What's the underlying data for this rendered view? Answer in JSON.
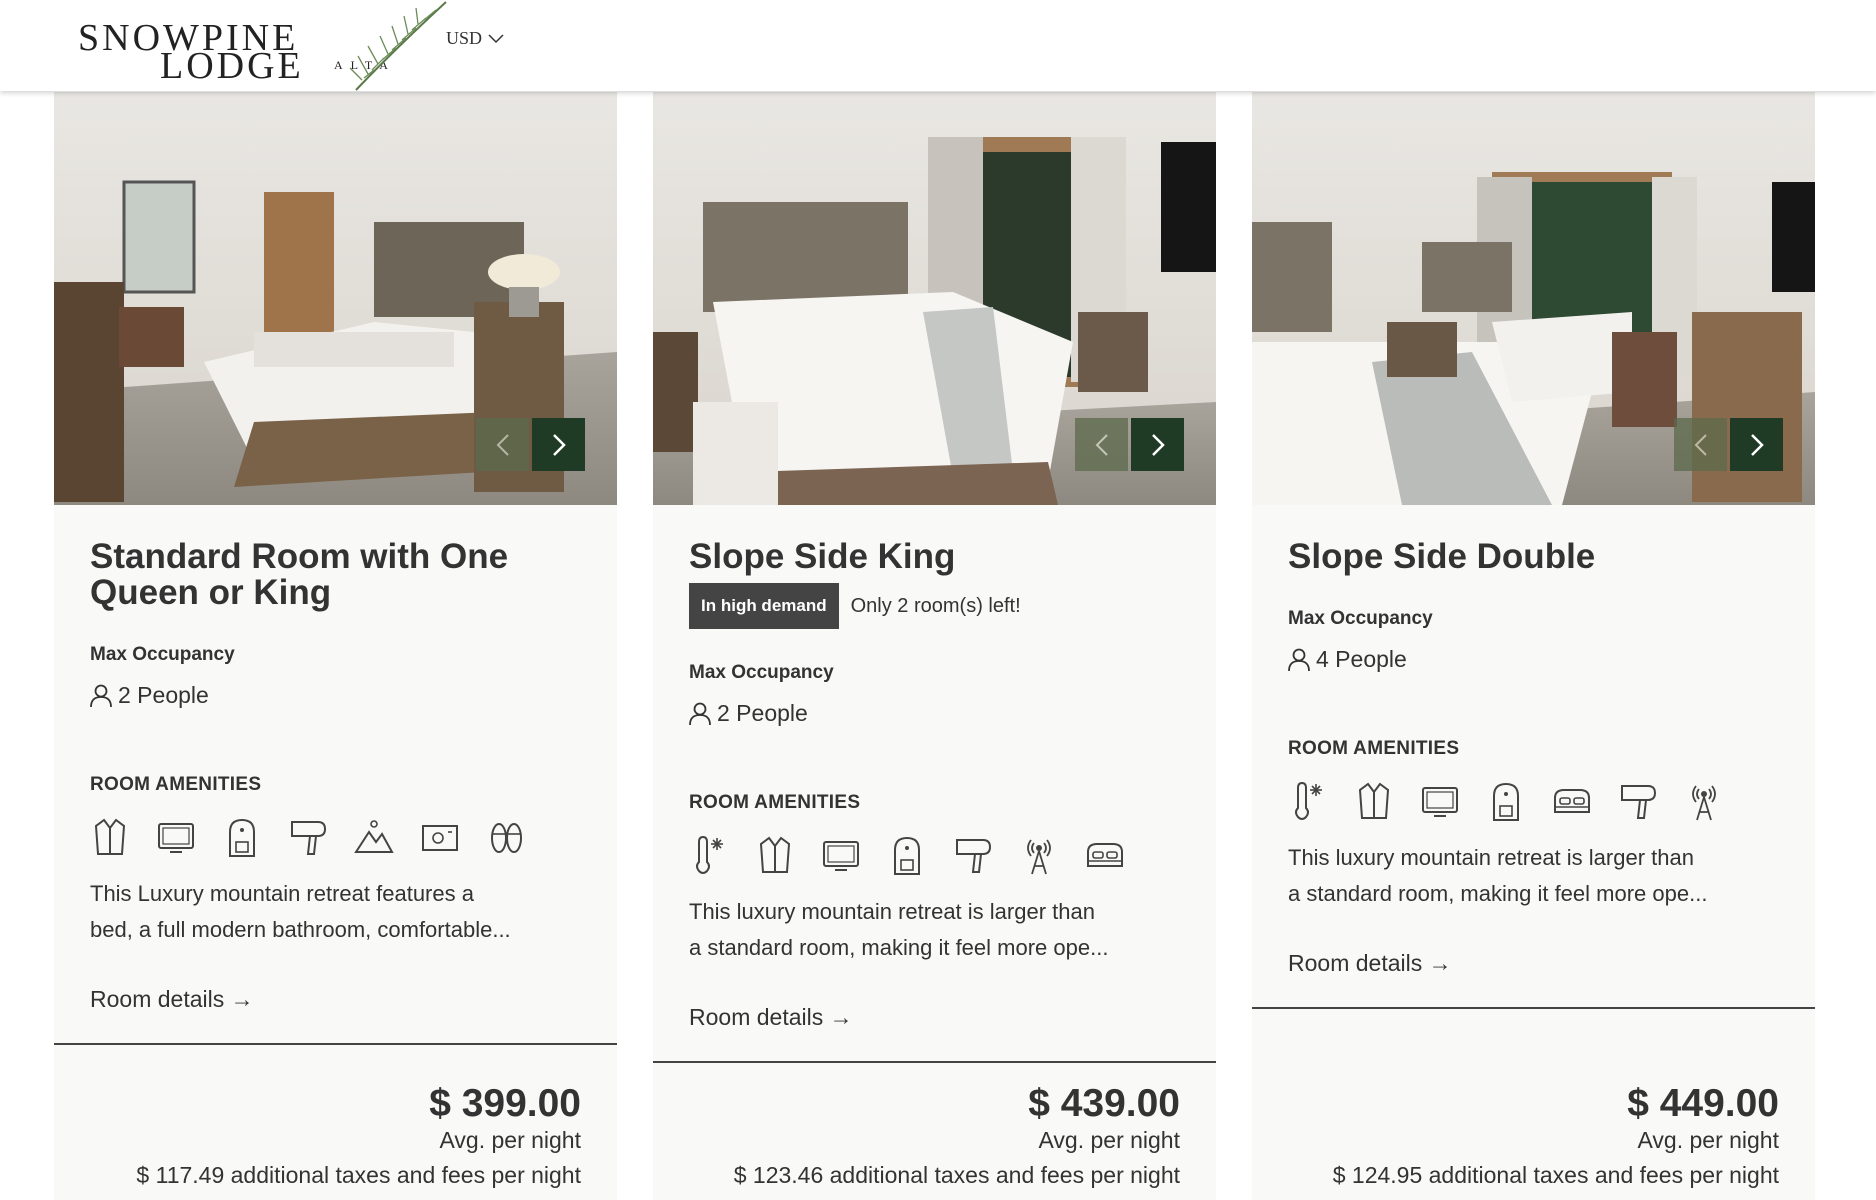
{
  "header": {
    "logo": {
      "line1": "SNOWPINE",
      "line2": "LODGE",
      "line3": "ALTA"
    },
    "currency": "USD"
  },
  "rooms": [
    {
      "title": "Standard Room with One Queen or King",
      "occupancy_label": "Max Occupancy",
      "occupancy": "2 People",
      "amenities_label": "ROOM AMENITIES",
      "amenities": [
        "robe-icon",
        "tv-icon",
        "coffee-maker-icon",
        "hair-dryer-icon",
        "mountain-view-icon",
        "safe-icon",
        "slippers-icon"
      ],
      "description_lines": [
        "This Luxury mountain retreat features a",
        "bed, a full modern bathroom, comfortable..."
      ],
      "details_link": "Room details →",
      "price": "$ 399.00",
      "price_note": "Avg. per night",
      "taxes": "$ 117.49 additional taxes and fees per night"
    },
    {
      "title": "Slope Side King",
      "badge": "In high demand",
      "badge_note": "Only 2 room(s) left!",
      "occupancy_label": "Max Occupancy",
      "occupancy": "2 People",
      "amenities_label": "ROOM AMENITIES",
      "amenities": [
        "air-conditioning-icon",
        "robe-icon",
        "tv-icon",
        "coffee-maker-icon",
        "hair-dryer-icon",
        "wifi-tower-icon",
        "bed-icon"
      ],
      "description_lines": [
        "This luxury mountain retreat is larger than",
        "a standard room, making it feel more ope..."
      ],
      "details_link": "Room details →",
      "price": "$ 439.00",
      "price_note": "Avg. per night",
      "taxes": "$ 123.46 additional taxes and fees per night"
    },
    {
      "title": "Slope Side Double",
      "occupancy_label": "Max Occupancy",
      "occupancy": "4 People",
      "amenities_label": "ROOM AMENITIES",
      "amenities": [
        "air-conditioning-icon",
        "robe-icon",
        "tv-icon",
        "coffee-maker-icon",
        "bed-icon",
        "hair-dryer-icon",
        "wifi-tower-icon"
      ],
      "description_lines": [
        "This luxury mountain retreat is larger than",
        "a standard room, making it feel more ope..."
      ],
      "details_link": "Room details →",
      "price": "$ 449.00",
      "price_note": "Avg. per night",
      "taxes": "$ 124.95 additional taxes and fees per night"
    }
  ],
  "colors": {
    "brand_green": "#1f3a25",
    "muted_green": "#5c6a4b",
    "badge": "#444444",
    "card_bg": "#f9f9f8"
  }
}
